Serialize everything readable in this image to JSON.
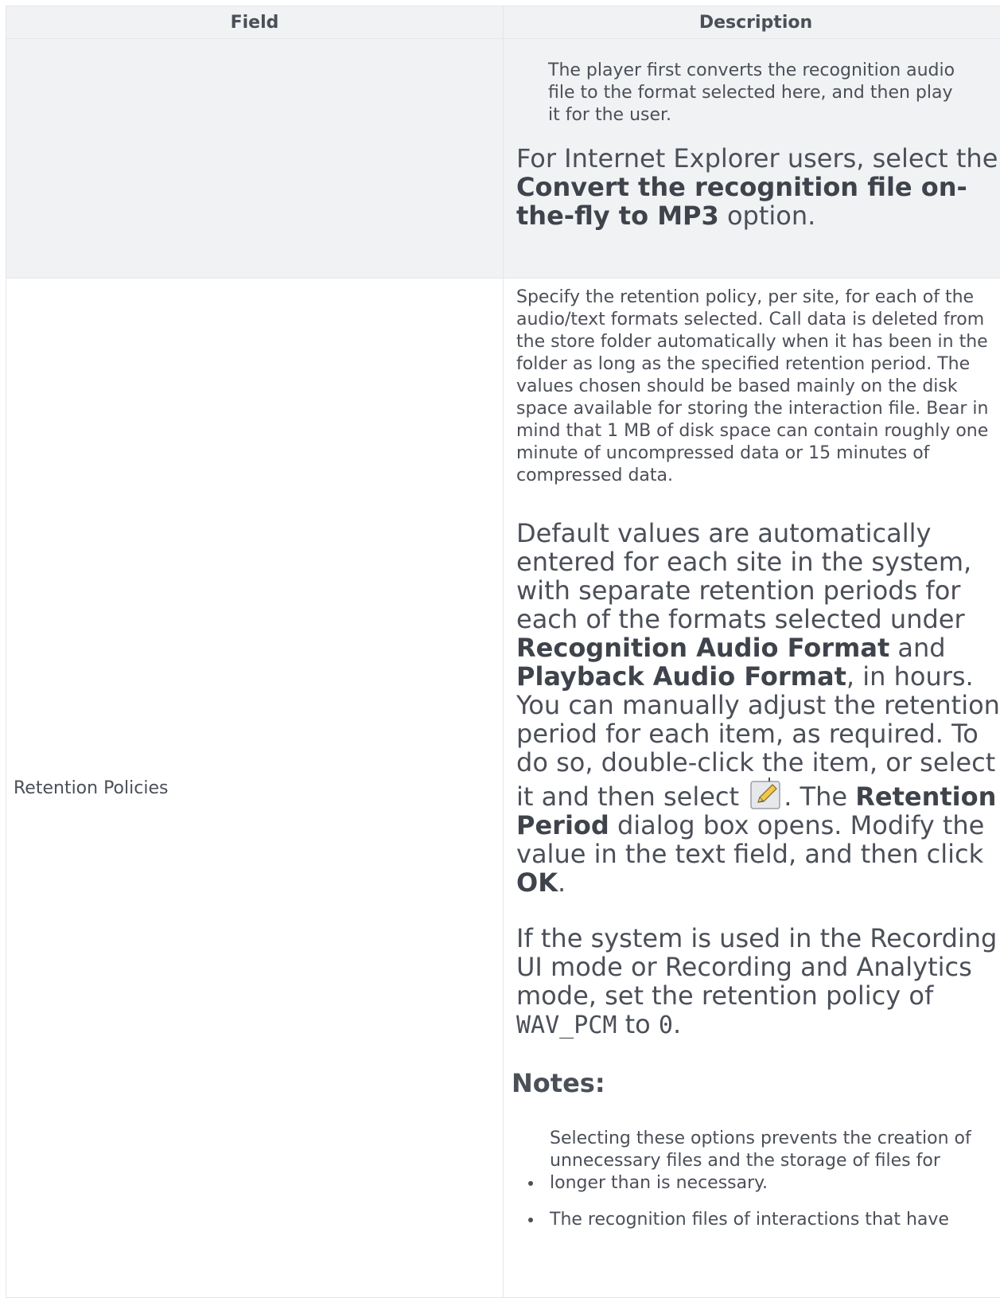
{
  "table": {
    "headers": {
      "field": "Field",
      "description": "Description"
    },
    "row1": {
      "field": "",
      "p1": "The player first converts the recognition audio file to the format selected here, and then play it for the user.",
      "p2_a": "For Internet Explorer users, select the ",
      "p2_b": "Convert the recognition file on-the-fly to MP3",
      "p2_c": " option."
    },
    "row2": {
      "field": "Retention Policies",
      "p1": "Specify the retention policy, per site, for each of the audio/text formats selected. Call data is deleted from the store folder automatically when it has been in the folder as long as the specified retention period. The values chosen should be based mainly on the disk space available for storing the interaction file. Bear in mind that 1 MB of disk space can contain roughly one minute of uncompressed data or 15 minutes of compressed data.",
      "p2_a": "Default values are automatically entered for each site in the system, with separate retention periods for each of the formats selected under ",
      "p2_b": "Recognition Audio Format",
      "p2_c": " and ",
      "p2_d": "Playback Audio Format",
      "p2_e": ", in hours. You can manually adjust the retention period for each item, as required. To do so, double-click the item, or select it and then select ",
      "p2_f": ". The ",
      "p2_g": "Retention Period",
      "p2_h": " dialog box opens. Modify the value in the text field, and then click ",
      "p2_i": "OK",
      "p2_j": ".",
      "p3_a": "If the system is used in the Recording UI mode or Recording and Analytics mode, set the retention policy of ",
      "p3_code1": "WAV_PCM",
      "p3_b": " to ",
      "p3_code2": "0",
      "p3_c": ".",
      "notes_heading": "Notes:",
      "notes": [
        "Selecting these options prevents the creation of unnecessary files and the storage of files for longer than is necessary.",
        "The recognition files of interactions that have"
      ],
      "edit_icon": "pencil-icon"
    }
  }
}
